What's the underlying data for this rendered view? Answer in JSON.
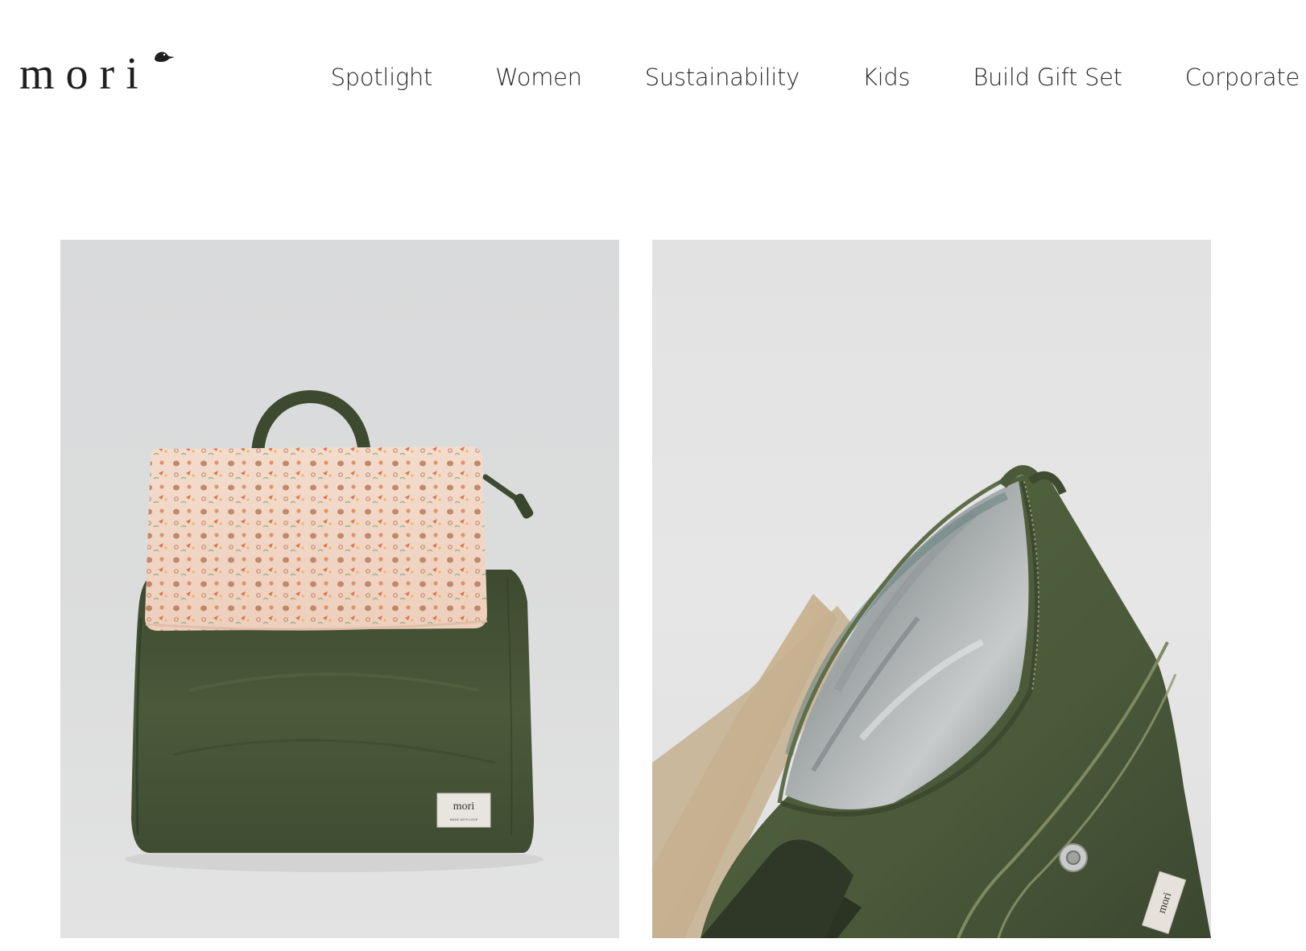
{
  "brand": {
    "logo_text": "mori"
  },
  "nav": {
    "items": [
      {
        "label": "Spotlight"
      },
      {
        "label": "Women"
      },
      {
        "label": "Sustainability"
      },
      {
        "label": "Kids"
      },
      {
        "label": "Build Gift Set"
      },
      {
        "label": "Corporate"
      }
    ]
  },
  "gallery": {
    "images": [
      {
        "label_text": "mori",
        "label_subtext": "MADE WITH LOVE"
      },
      {
        "label_text": "mori"
      }
    ]
  },
  "colors": {
    "bag_green": "#4a5a3a",
    "flap_peach": "#f1d8c8",
    "background": "#ffffff",
    "text": "#2a2a2a"
  }
}
